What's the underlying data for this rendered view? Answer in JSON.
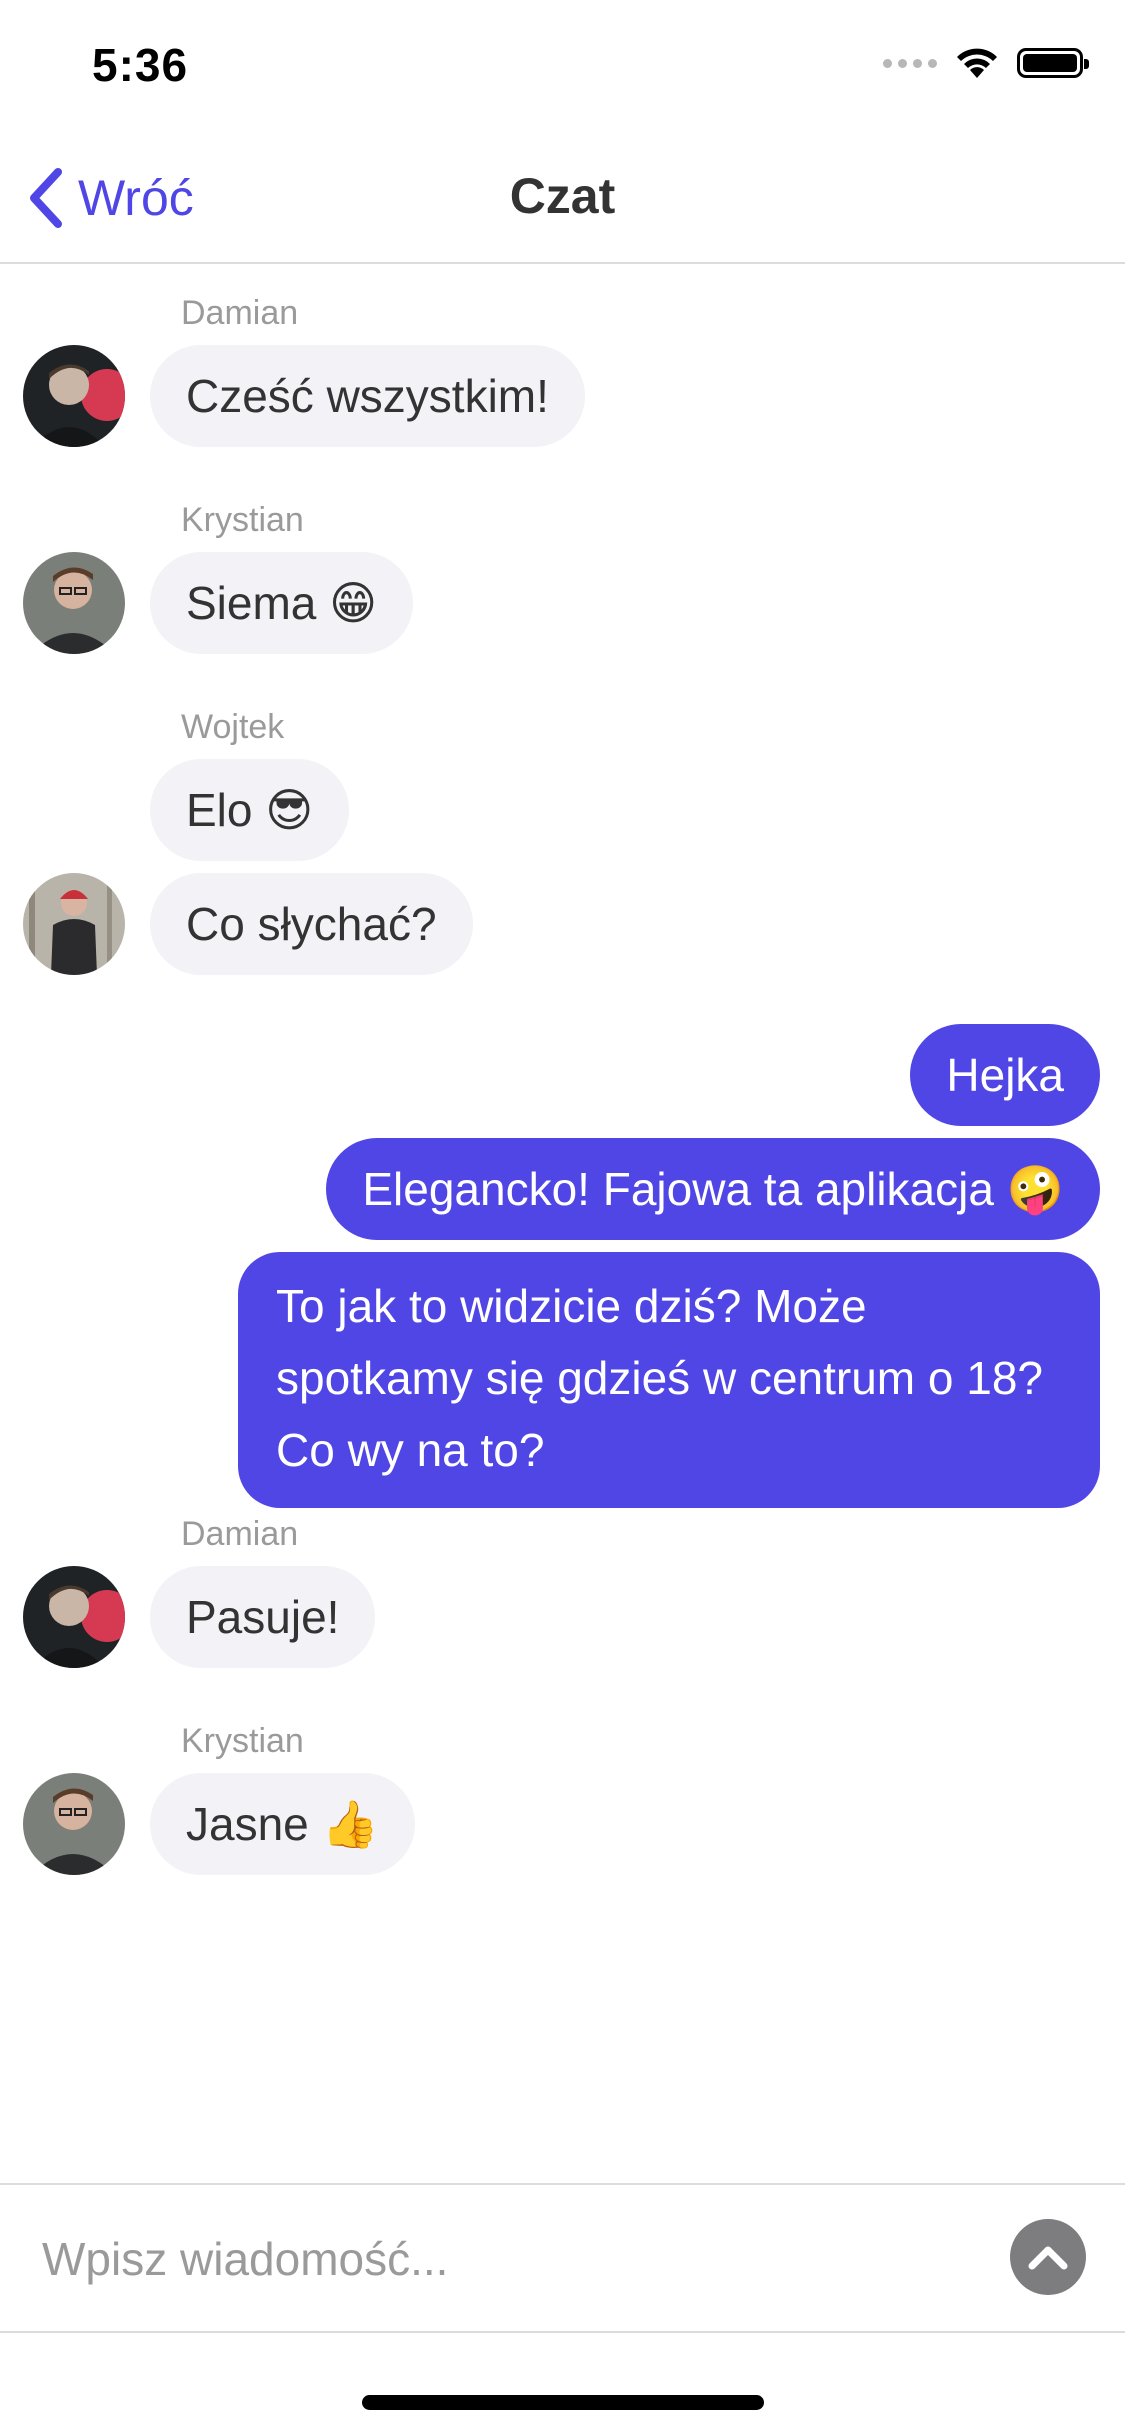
{
  "status_bar": {
    "time": "5:36",
    "icons": [
      "signal-icon",
      "wifi-icon",
      "battery-icon"
    ]
  },
  "nav": {
    "back_label": "Wróć",
    "title": "Czat",
    "back_icon": "chevron-left-icon"
  },
  "messages": [
    {
      "sender": "Damian",
      "text": "Cześć wszystkim!",
      "direction": "in"
    },
    {
      "sender": "Krystian",
      "text": "Siema 😁",
      "direction": "in"
    },
    {
      "sender": "Wojtek",
      "text": "Elo 😎",
      "direction": "in"
    },
    {
      "text": "Co słychać?",
      "direction": "in"
    },
    {
      "text": "Hejka",
      "direction": "out"
    },
    {
      "text": "Elegancko! Fajowa ta aplikacja 🤪",
      "direction": "out"
    },
    {
      "text": "To jak to widzicie dziś? Może spotkamy się gdzieś w centrum o 18? Co wy na to?",
      "direction": "out"
    },
    {
      "sender": "Damian",
      "text": "Pasuje!",
      "direction": "in"
    },
    {
      "sender": "Krystian",
      "text": "Jasne 👍",
      "direction": "in"
    }
  ],
  "composer": {
    "placeholder": "Wpisz wiadomość...",
    "send_icon": "chevron-up-icon"
  },
  "colors": {
    "accent": "#5046e5",
    "incoming_bubble": "#f2f2f7",
    "sender_label": "#9a9a9a",
    "send_button": "#7d7d80"
  }
}
